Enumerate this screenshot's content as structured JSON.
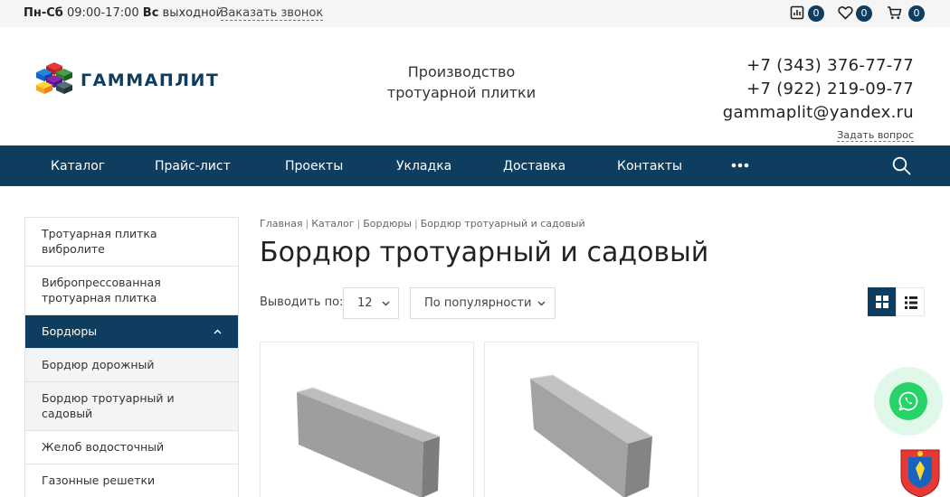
{
  "topbar": {
    "days1": "Пн-Сб",
    "hours": "09:00-17:00",
    "days2": "Вс",
    "off": "выходной",
    "callback": "Заказать звонок",
    "compare_count": "0",
    "favorites_count": "0",
    "cart_count": "0"
  },
  "header": {
    "logo_text": "ГАММАПЛИТ",
    "tagline_line1": "Производство",
    "tagline_line2": "тротуарной плитки",
    "phone1": "+7 (343) 376-77-77",
    "phone2": "+7 (922) 219-09-77",
    "email": "gammaplit@yandex.ru",
    "ask": "Задать вопрос"
  },
  "nav": {
    "items": [
      "Каталог",
      "Прайс-лист",
      "Проекты",
      "Укладка",
      "Доставка",
      "Контакты"
    ]
  },
  "sidebar": {
    "items": [
      "Тротуарная плитка вибролите",
      "Вибропрессованная тротуарная плитка",
      "Бордюры",
      "Бордюр дорожный",
      "Бордюр тротуарный и садовый",
      "Желоб водосточный",
      "Газонные решетки"
    ]
  },
  "breadcrumb": [
    "Главная",
    "Каталог",
    "Бордюры",
    "Бордюр тротуарный и садовый"
  ],
  "page": {
    "title": "Бордюр тротуарный и садовый",
    "show_label": "Выводить по:",
    "per_page": "12",
    "sort": "По популярности"
  },
  "colors": {
    "brand": "#0e3d5f",
    "whatsapp": "#25d366"
  }
}
